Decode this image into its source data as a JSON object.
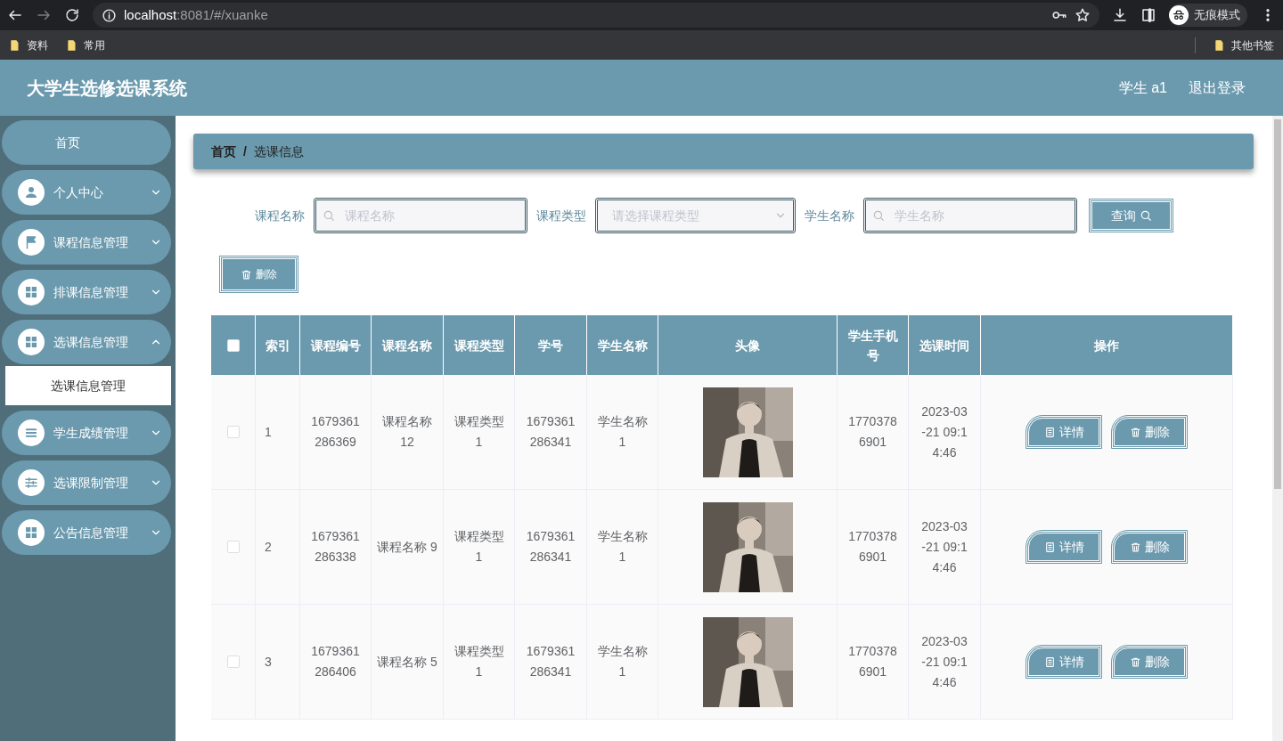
{
  "browser": {
    "url_host": "localhost",
    "url_path": ":8081/#/xuanke",
    "profile": "无痕模式",
    "bookmarks": [
      "资料",
      "常用"
    ],
    "other_bookmarks": "其他书签"
  },
  "header": {
    "title": "大学生选修选课系统",
    "user": "学生 a1",
    "logout": "退出登录"
  },
  "sidebar": {
    "items": [
      {
        "label": "首页"
      },
      {
        "label": "个人中心",
        "expanded": false
      },
      {
        "label": "课程信息管理",
        "expanded": false
      },
      {
        "label": "排课信息管理",
        "expanded": false
      },
      {
        "label": "选课信息管理",
        "expanded": true,
        "children": [
          {
            "label": "选课信息管理",
            "selected": true
          }
        ]
      },
      {
        "label": "学生成绩管理",
        "expanded": false
      },
      {
        "label": "选课限制管理",
        "expanded": false
      },
      {
        "label": "公告信息管理",
        "expanded": false
      }
    ]
  },
  "breadcrumb": [
    "首页",
    "/",
    "选课信息"
  ],
  "select_all_checked": false,
  "filters": [
    {
      "kind": "search",
      "label": "课程名称",
      "placeholder": "课程名称"
    },
    {
      "kind": "select",
      "label": "课程类型",
      "placeholder": "请选择课程类型"
    },
    {
      "kind": "search",
      "label": "学生名称",
      "placeholder": "学生名称"
    }
  ],
  "query_button": "查询",
  "delete_button": "删除",
  "table": {
    "columns": [
      "索引",
      "课程编号",
      "课程名称",
      "课程类型",
      "学号",
      "学生名称",
      "头像",
      "学生手机号",
      "选课时间",
      "操作"
    ],
    "rows": [
      {
        "checked": false,
        "index": "1",
        "course_no": "1679361 286369",
        "course_name": "课程名称 12",
        "course_type": "课程类型 1",
        "student_no": "1679361 286341",
        "student_name": "学生名称 1",
        "phone": "1770378 6901",
        "time": "2023-03 -21 09:1 4:46",
        "actions": [
          "详情",
          "删除"
        ]
      },
      {
        "checked": false,
        "index": "2",
        "course_no": "1679361 286338",
        "course_name": "课程名称 9",
        "course_type": "课程类型 1",
        "student_no": "1679361 286341",
        "student_name": "学生名称 1",
        "phone": "1770378 6901",
        "time": "2023-03 -21 09:1 4:46",
        "actions": [
          "详情",
          "删除"
        ]
      },
      {
        "checked": false,
        "index": "3",
        "course_no": "1679361 286406",
        "course_name": "课程名称 5",
        "course_type": "课程类型 1",
        "student_no": "1679361 286341",
        "student_name": "学生名称 1",
        "phone": "1770378 6901",
        "time": "2023-03 -21 09:1 4:46",
        "actions": [
          "详情",
          "删除"
        ]
      }
    ]
  }
}
